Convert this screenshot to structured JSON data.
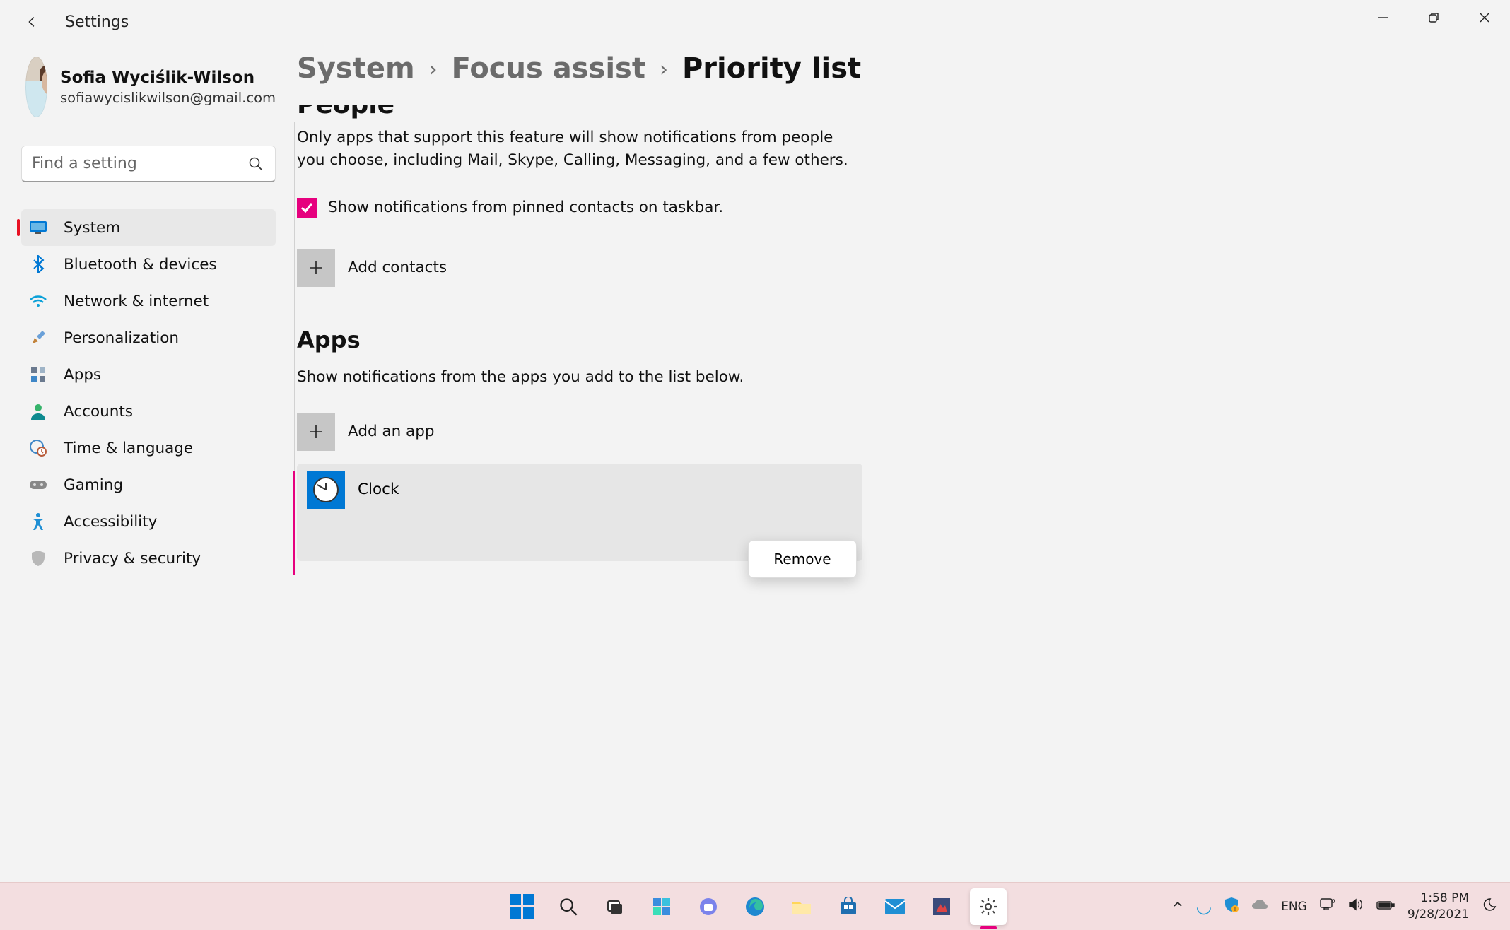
{
  "window": {
    "app_name": "Settings"
  },
  "profile": {
    "name": "Sofia Wyciślik-Wilson",
    "email": "sofiawycislikwilson@gmail.com"
  },
  "search": {
    "placeholder": "Find a setting"
  },
  "sidebar": {
    "items": [
      {
        "label": "System",
        "icon": "monitor-icon",
        "active": true
      },
      {
        "label": "Bluetooth & devices",
        "icon": "bluetooth-icon"
      },
      {
        "label": "Network & internet",
        "icon": "wifi-icon"
      },
      {
        "label": "Personalization",
        "icon": "brush-icon"
      },
      {
        "label": "Apps",
        "icon": "apps-icon"
      },
      {
        "label": "Accounts",
        "icon": "person-icon"
      },
      {
        "label": "Time & language",
        "icon": "globe-clock-icon"
      },
      {
        "label": "Gaming",
        "icon": "gamepad-icon"
      },
      {
        "label": "Accessibility",
        "icon": "accessibility-icon"
      },
      {
        "label": "Privacy & security",
        "icon": "shield-icon"
      }
    ]
  },
  "breadcrumb": {
    "items": [
      {
        "label": "System"
      },
      {
        "label": "Focus assist"
      },
      {
        "label": "Priority list",
        "current": true
      }
    ]
  },
  "content": {
    "people": {
      "heading": "People",
      "description": "Only apps that support this feature will show notifications from people you choose, including Mail, Skype, Calling, Messaging, and a few others.",
      "checkbox_label": "Show notifications from pinned contacts on taskbar.",
      "checkbox_checked": true,
      "add_label": "Add contacts"
    },
    "apps": {
      "heading": "Apps",
      "description": "Show notifications from the apps you add to the list below.",
      "add_label": "Add an app",
      "list": [
        {
          "name": "Clock",
          "icon": "clock-app-icon",
          "selected": true
        }
      ],
      "context_menu": {
        "remove": "Remove"
      }
    }
  },
  "taskbar": {
    "tray": {
      "language": "ENG",
      "time": "1:58 PM",
      "date": "9/28/2021"
    }
  }
}
